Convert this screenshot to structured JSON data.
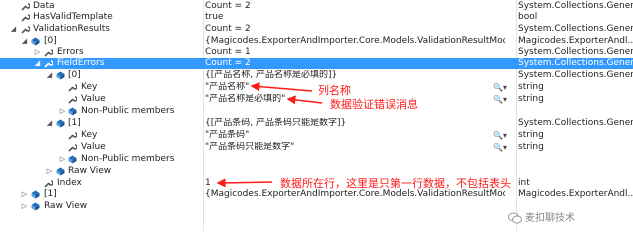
{
  "watch": {
    "rows": [
      {
        "name": "Data",
        "value": "Count = 2",
        "type": "System.Collections.Generi..."
      },
      {
        "name": "HasValidTemplate",
        "value": "true",
        "type": "bool"
      },
      {
        "name": "ValidationResults",
        "value": "Count = 2",
        "type": "System.Collections.Generi..."
      },
      {
        "name": "[0]",
        "value": "{Magicodes.ExporterAndImporter.Core.Models.ValidationResultModel}",
        "type": "Magicodes.ExporterAndl..."
      },
      {
        "name": "Errors",
        "value": "Count = 1",
        "type": "System.Collections.Generi..."
      },
      {
        "name": "FieldErrors",
        "value": "Count = 2",
        "type": "System.Collections.Generi..."
      },
      {
        "name": "[0]",
        "value": "{[产品名称, 产品名称是必填的]}",
        "type": "System.Collections.Generi..."
      },
      {
        "name": "Key",
        "value": "\"产品名称\"",
        "type": "string"
      },
      {
        "name": "Value",
        "value": "\"产品名称是必填的\"",
        "type": "string"
      },
      {
        "name": "Non-Public members",
        "value": "",
        "type": ""
      },
      {
        "name": "[1]",
        "value": "{[产品条码, 产品条码只能是数字]}",
        "type": "System.Collections.Generi..."
      },
      {
        "name": "Key",
        "value": "\"产品条码\"",
        "type": "string"
      },
      {
        "name": "Value",
        "value": "\"产品条码只能是数字\"",
        "type": "string"
      },
      {
        "name": "Non-Public members",
        "value": "",
        "type": ""
      },
      {
        "name": "Raw View",
        "value": "",
        "type": ""
      },
      {
        "name": "Index",
        "value": "1",
        "type": "int"
      },
      {
        "name": "[1]",
        "value": "{Magicodes.ExporterAndImporter.Core.Models.ValidationResultModel}",
        "type": "Magicodes.ExporterAndl..."
      },
      {
        "name": "Raw View",
        "value": "",
        "type": ""
      }
    ]
  },
  "annotations": {
    "column_name": "列名称",
    "validation_message": "数据验证错误消息",
    "row_index": "数据所在行，这里是只第一行数据，不包括表头"
  },
  "watermark": {
    "text": "麦扣聊技术"
  },
  "colors": {
    "selection": "#3399ff",
    "annotation": "#ff1a1a",
    "wrench_icon": "#5a5a5a",
    "field_icon": "#1f6fbf"
  }
}
